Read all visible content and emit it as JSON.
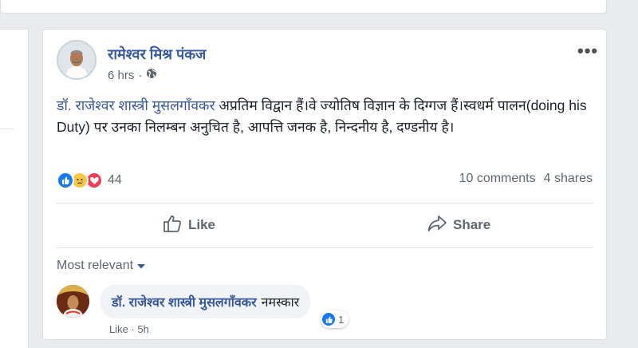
{
  "post": {
    "author": "रामेश्वर मिश्र पंकज",
    "time": "6 hrs",
    "privacy_icon": "globe-icon",
    "more_label": "•••",
    "mention": "डॉ. राजेश्वर शास्त्री मुसलगाँवकर",
    "text": " अप्रतिम विद्वान हैं।वे ज्योतिष विज्ञान के दिग्गज हैं।स्वधर्म पालन(doing his Duty) पर उनका निलम्बन अनुचित है, आपत्ति जनक है, निन्दनीय है, दण्डनीय है।",
    "reaction_icons": [
      "like-icon",
      "sad-icon",
      "love-icon"
    ],
    "reaction_count": "44",
    "comments_count": "10 comments",
    "shares_count": "4 shares"
  },
  "actions": {
    "like_label": "Like",
    "share_label": "Share"
  },
  "comments": {
    "sort_label": "Most relevant",
    "first": {
      "author": "डॉ. राजेश्वर शास्त्री मुसलगाँवकर",
      "text": "नमस्कार",
      "reaction_count": "1",
      "meta": "Like · 5h"
    }
  },
  "colors": {
    "link": "#385898",
    "like_blue": "#1877f2",
    "love_red": "#f33e58",
    "sad_yellow": "#f7c645",
    "background": "#e9ebee"
  }
}
